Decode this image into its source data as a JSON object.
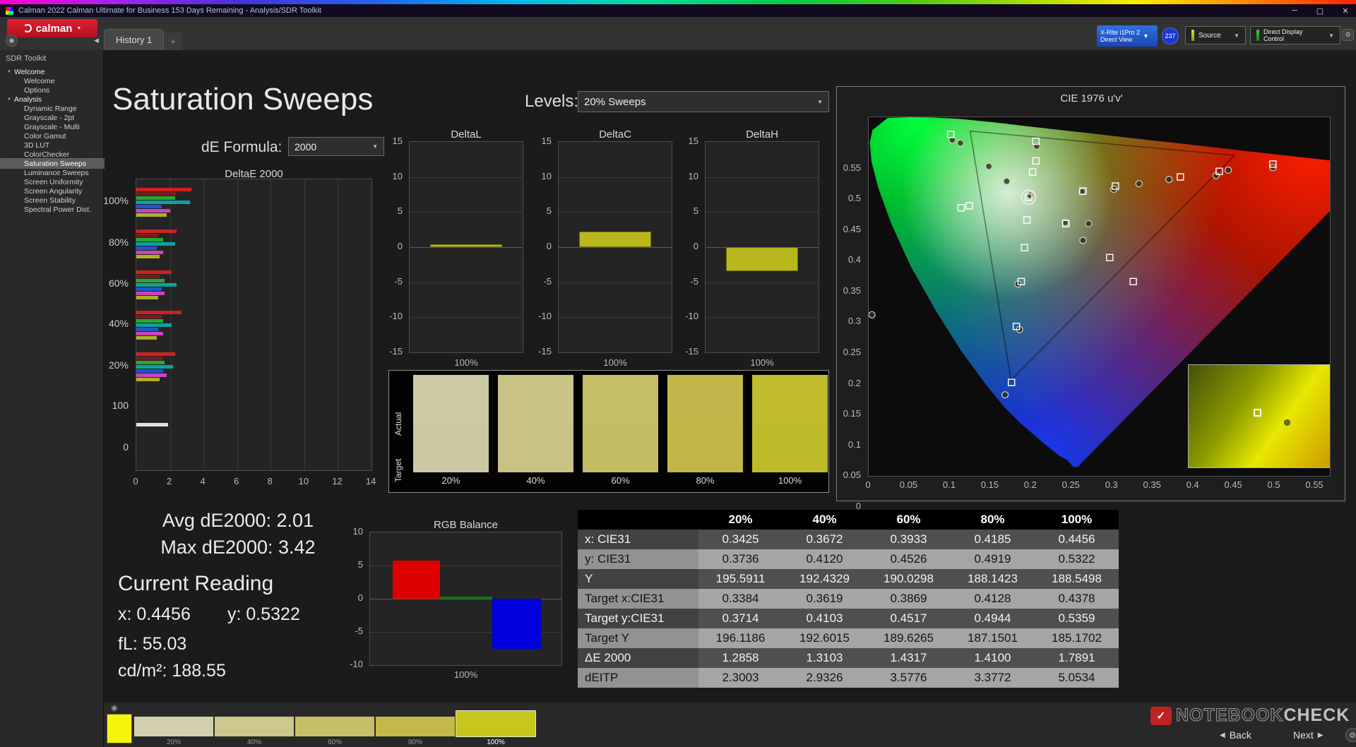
{
  "window": {
    "title": "Calman 2022 Calman Ultimate for Business 153 Days Remaining  - Analysis/SDR Toolkit"
  },
  "icons": {
    "minimize": "─",
    "maximize": "▢",
    "close": "✕",
    "caret": "▼",
    "collapse": "◀",
    "plus": "+",
    "gear": "⚙",
    "info": "◉",
    "tree_expanded": "▼",
    "back": "◀",
    "next": "▶",
    "eye": "◉",
    "check": "✓"
  },
  "toolbar": {
    "history_tab": "History 1",
    "meter_line1": "X-Rite i1Pro 2",
    "meter_line2": "Direct View",
    "badge": "237",
    "source": "Source",
    "display_control": "Direct Display Control"
  },
  "sidebar": {
    "logo": "calman",
    "toolkit_label": "SDR Toolkit",
    "tree": [
      {
        "label": "Welcome",
        "level": 0,
        "expanded": true
      },
      {
        "label": "Welcome",
        "level": 1
      },
      {
        "label": "Options",
        "level": 1
      },
      {
        "label": "Analysis",
        "level": 0,
        "expanded": true
      },
      {
        "label": "Dynamic Range",
        "level": 1
      },
      {
        "label": "Grayscale - 2pt",
        "level": 1
      },
      {
        "label": "Grayscale - Multi",
        "level": 1
      },
      {
        "label": "Color Gamut",
        "level": 1
      },
      {
        "label": "3D LUT",
        "level": 1
      },
      {
        "label": "ColorChecker",
        "level": 1
      },
      {
        "label": "Saturation Sweeps",
        "level": 1,
        "selected": true
      },
      {
        "label": "Luminance Sweeps",
        "level": 1
      },
      {
        "label": "Screen Uniformity",
        "level": 1
      },
      {
        "label": "Screen Angularity",
        "level": 1
      },
      {
        "label": "Screen Stability",
        "level": 1
      },
      {
        "label": "Spectral Power Dist.",
        "level": 1
      }
    ]
  },
  "page": {
    "title": "Saturation Sweeps",
    "levels_label": "Levels:",
    "levels_value": "20% Sweeps",
    "formula_label": "dE Formula:",
    "formula_value": "2000"
  },
  "readings": {
    "avg": "Avg dE2000: 2.01",
    "max": "Max dE2000: 3.42",
    "heading": "Current Reading",
    "x": "x: 0.4456",
    "y": "y: 0.5322",
    "fl": "fL: 55.03",
    "cd": "cd/m²: 188.55"
  },
  "chart_data": [
    {
      "id": "deltae2000",
      "type": "bar",
      "orientation": "horizontal",
      "title": "DeltaE 2000",
      "xlim": [
        0,
        14
      ],
      "xticks": [
        0,
        2,
        4,
        6,
        8,
        10,
        12,
        14
      ],
      "series_colors": [
        "#cc2222",
        "#7a1a1a",
        "#22aa33",
        "#11a0a0",
        "#2255cc",
        "#cc44bb",
        "#b0b022"
      ],
      "groups": [
        {
          "label": "100%",
          "values": [
            3.3,
            2.4,
            2.3,
            3.2,
            1.5,
            2.0,
            1.8
          ]
        },
        {
          "label": "80%",
          "values": [
            2.4,
            1.3,
            1.6,
            2.3,
            1.2,
            1.6,
            1.4
          ]
        },
        {
          "label": "60%",
          "values": [
            2.1,
            1.4,
            1.7,
            2.4,
            1.5,
            1.7,
            1.3
          ]
        },
        {
          "label": "40%",
          "values": [
            2.7,
            1.5,
            1.6,
            2.1,
            1.3,
            1.6,
            1.2
          ]
        },
        {
          "label": "20%",
          "values": [
            2.3,
            1.6,
            1.7,
            2.2,
            1.6,
            1.8,
            1.4
          ]
        },
        {
          "label": "100",
          "values": [
            1.9
          ],
          "colors": [
            "#e2e2e2"
          ]
        },
        {
          "label": "0",
          "values": []
        }
      ]
    },
    {
      "id": "deltaL",
      "type": "bar",
      "title": "DeltaL",
      "xlabel": "100%",
      "categories": [
        "100%"
      ],
      "values": [
        0.4
      ],
      "ylim": [
        -15,
        15
      ],
      "yticks": [
        15,
        10,
        5,
        0,
        -5,
        -10,
        -15
      ],
      "bar_color": "#b8b81e"
    },
    {
      "id": "deltaC",
      "type": "bar",
      "title": "DeltaC",
      "xlabel": "100%",
      "categories": [
        "100%"
      ],
      "values": [
        2.2
      ],
      "ylim": [
        -15,
        15
      ],
      "yticks": [
        15,
        10,
        5,
        0,
        -5,
        -10,
        -15
      ],
      "bar_color": "#b8b81e"
    },
    {
      "id": "deltaH",
      "type": "bar",
      "title": "DeltaH",
      "xlabel": "100%",
      "categories": [
        "100%"
      ],
      "values": [
        -3.4
      ],
      "ylim": [
        -15,
        15
      ],
      "yticks": [
        15,
        10,
        5,
        0,
        -5,
        -10,
        -15
      ],
      "bar_color": "#b8b81e"
    },
    {
      "id": "rgb_balance",
      "type": "bar",
      "title": "RGB Balance",
      "xlabel": "100%",
      "categories": [
        "Red",
        "Green",
        "Blue"
      ],
      "values": [
        5.7,
        0.3,
        -7.5
      ],
      "colors": [
        "#dd0000",
        "#0a7a0a",
        "#0000dd"
      ],
      "ylim": [
        -10,
        10
      ],
      "yticks": [
        10,
        5,
        0,
        -5,
        -10
      ]
    },
    {
      "id": "cie1976",
      "type": "scatter",
      "title": "CIE 1976 u'v'",
      "xlim": [
        0,
        0.57
      ],
      "ylim": [
        0,
        0.585
      ],
      "xticks": [
        "0",
        "0.05",
        "0.1",
        "0.15",
        "0.2",
        "0.25",
        "0.3",
        "0.35",
        "0.4",
        "0.45",
        "0.5",
        "0.55"
      ],
      "yticks": [
        "0",
        "0.05",
        "0.1",
        "0.15",
        "0.2",
        "0.25",
        "0.3",
        "0.35",
        "0.4",
        "0.45",
        "0.5",
        "0.55"
      ],
      "targets": [
        [
          0.101,
          0.557
        ],
        [
          0.206,
          0.546
        ],
        [
          0.206,
          0.514
        ],
        [
          0.202,
          0.496
        ],
        [
          0.197,
          0.455
        ],
        [
          0.432,
          0.497
        ],
        [
          0.498,
          0.509
        ],
        [
          0.384,
          0.488
        ],
        [
          0.304,
          0.473
        ],
        [
          0.264,
          0.465
        ],
        [
          0.124,
          0.441
        ],
        [
          0.114,
          0.438
        ],
        [
          0.195,
          0.418
        ],
        [
          0.243,
          0.412
        ],
        [
          0.192,
          0.373
        ],
        [
          0.297,
          0.357
        ],
        [
          0.326,
          0.318
        ],
        [
          0.188,
          0.318
        ],
        [
          0.182,
          0.245
        ],
        [
          0.176,
          0.154
        ]
      ],
      "measurements": [
        [
          0.113,
          0.543
        ],
        [
          0.148,
          0.505
        ],
        [
          0.17,
          0.481
        ],
        [
          0.263,
          0.464
        ],
        [
          0.333,
          0.477
        ],
        [
          0.37,
          0.484
        ],
        [
          0.443,
          0.499
        ],
        [
          0.242,
          0.414
        ],
        [
          0.271,
          0.412
        ],
        [
          0.264,
          0.385
        ],
        [
          0.184,
          0.314
        ],
        [
          0.186,
          0.24
        ],
        [
          0.168,
          0.134
        ],
        [
          0.004,
          0.264
        ],
        [
          0.103,
          0.548
        ],
        [
          0.207,
          0.538
        ],
        [
          0.428,
          0.49
        ],
        [
          0.302,
          0.468
        ],
        [
          0.498,
          0.503
        ],
        [
          0.199,
          0.458
        ]
      ],
      "highlight": [
        0.197,
        0.455
      ],
      "inset": {
        "target": [
          0.45,
          0.46
        ],
        "measurement": [
          0.64,
          0.56
        ]
      }
    }
  ],
  "saturation_swatches": {
    "row_labels": [
      "Actual",
      "Target"
    ],
    "items": [
      {
        "label": "20%",
        "actual": "#cccaa4",
        "target": "#cbc9a2"
      },
      {
        "label": "40%",
        "actual": "#c9c386",
        "target": "#c8c284"
      },
      {
        "label": "60%",
        "actual": "#c6bd68",
        "target": "#c5bc66"
      },
      {
        "label": "80%",
        "actual": "#c3b74b",
        "target": "#c2b648"
      },
      {
        "label": "100%",
        "actual": "#c0bc2e",
        "target": "#bcbc2a"
      }
    ]
  },
  "table": {
    "headers": [
      "",
      "20%",
      "40%",
      "60%",
      "80%",
      "100%"
    ],
    "rows": [
      {
        "label": "x: CIE31",
        "values": [
          "0.3425",
          "0.3672",
          "0.3933",
          "0.4185",
          "0.4456"
        ]
      },
      {
        "label": "y: CIE31",
        "values": [
          "0.3736",
          "0.4120",
          "0.4526",
          "0.4919",
          "0.5322"
        ]
      },
      {
        "label": "Y",
        "values": [
          "195.5911",
          "192.4329",
          "190.0298",
          "188.1423",
          "188.5498"
        ]
      },
      {
        "label": "Target x:CIE31",
        "values": [
          "0.3384",
          "0.3619",
          "0.3869",
          "0.4128",
          "0.4378"
        ]
      },
      {
        "label": "Target y:CIE31",
        "values": [
          "0.3714",
          "0.4103",
          "0.4517",
          "0.4944",
          "0.5359"
        ]
      },
      {
        "label": "Target Y",
        "values": [
          "196.1186",
          "192.6015",
          "189.6265",
          "187.1501",
          "185.1702"
        ]
      },
      {
        "label": "ΔE 2000",
        "values": [
          "1.2858",
          "1.3103",
          "1.4317",
          "1.4100",
          "1.7891"
        ]
      },
      {
        "label": "dEITP",
        "values": [
          "2.3003",
          "2.9326",
          "3.5776",
          "3.3772",
          "5.0534"
        ]
      }
    ]
  },
  "bottom_swatches": {
    "selected_color": "#f5f50a",
    "items": [
      {
        "label": "20%",
        "color": "#d2d0ad"
      },
      {
        "label": "40%",
        "color": "#ccc78b"
      },
      {
        "label": "60%",
        "color": "#c7bf68"
      },
      {
        "label": "80%",
        "color": "#c4b948"
      },
      {
        "label": "100%",
        "color": "#c6c61e",
        "selected": true
      }
    ]
  },
  "footer": {
    "back": "Back",
    "next": "Next"
  },
  "watermark": {
    "prefix": "NOTEBOOK",
    "suffix": "CHECK"
  }
}
